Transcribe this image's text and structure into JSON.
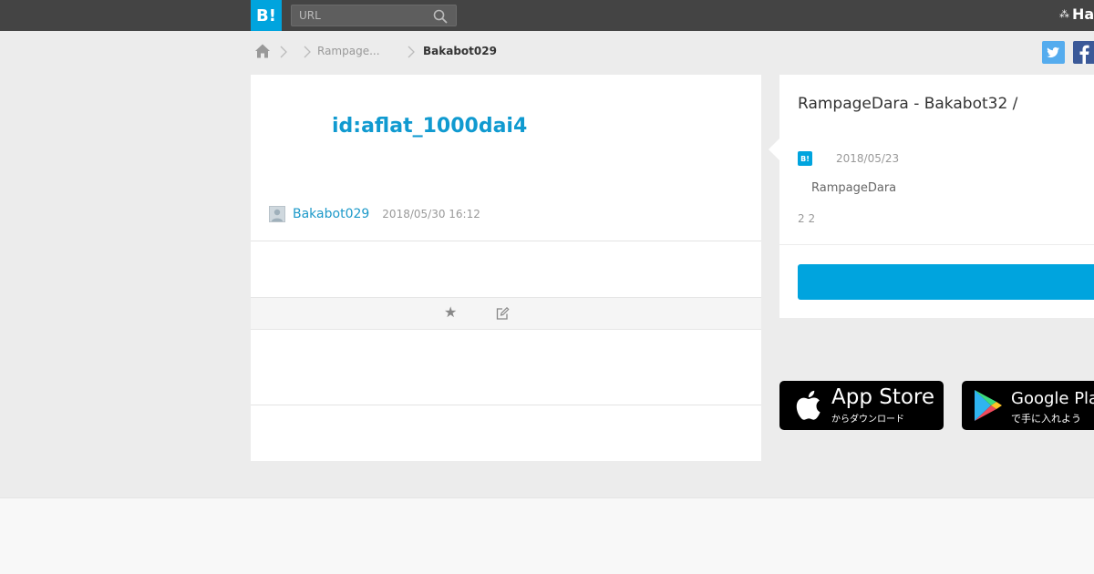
{
  "header": {
    "logo": "B!",
    "search_placeholder": "URL",
    "brand_partial": "Ha"
  },
  "breadcrumb": {
    "items": [
      "Rampage...",
      "Bakabot029"
    ]
  },
  "entry": {
    "title": "id:aflat_1000dai4",
    "username": "Bakabot029",
    "timestamp": "2018/05/30 16:12"
  },
  "side": {
    "title": "RampageDara - Bakabot32 /",
    "badge": "B!",
    "date": "2018/05/23",
    "user": "RampageDara",
    "count": "2 2"
  },
  "apps": {
    "appstore_main": "App Store",
    "appstore_sub": "からダウンロード",
    "gplay_main": "Google Play",
    "gplay_sub": "で手に入れよう"
  },
  "colors": {
    "accent": "#00a4de",
    "header_bg": "#444444",
    "link": "#1c99c9"
  }
}
